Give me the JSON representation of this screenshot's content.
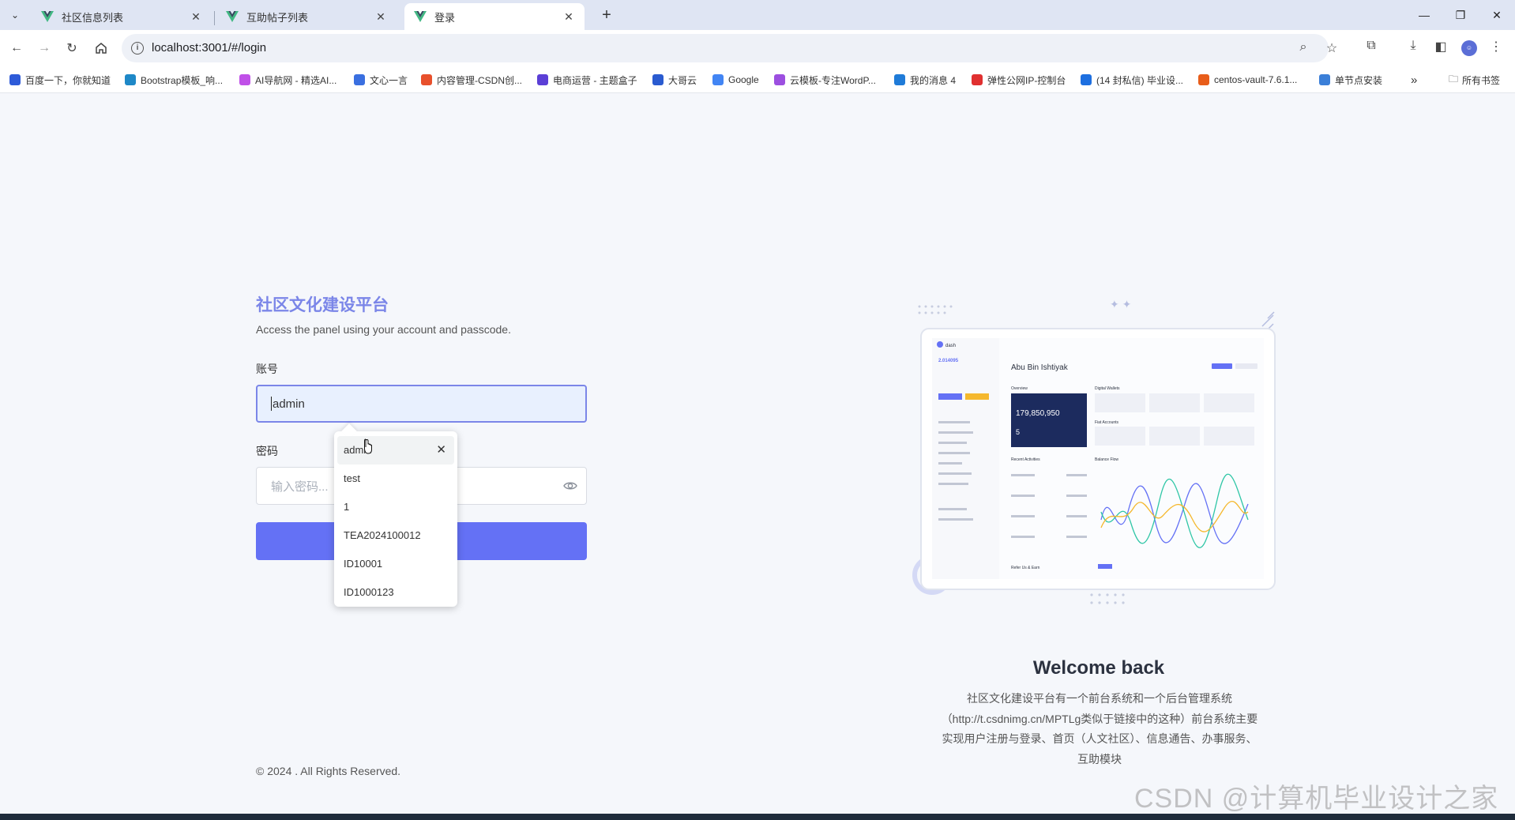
{
  "browser": {
    "tabs": [
      {
        "title": "社区信息列表",
        "active": false
      },
      {
        "title": "互助帖子列表",
        "active": false
      },
      {
        "title": "登录",
        "active": true
      }
    ],
    "url": "localhost:3001/#/login",
    "bookmarks": [
      {
        "label": "百度一下，你就知道",
        "icon_color": "#2e5bd8"
      },
      {
        "label": "Bootstrap模板_响...",
        "icon_color": "#1e88c7"
      },
      {
        "label": "AI导航网 - 精选AI...",
        "icon_color": "#c050e8"
      },
      {
        "label": "文心一言",
        "icon_color": "#3a6fe0"
      },
      {
        "label": "内容管理-CSDN创...",
        "icon_color": "#e8502c"
      },
      {
        "label": "电商运营 - 主题盒子",
        "icon_color": "#5b3fd6"
      },
      {
        "label": "大哥云",
        "icon_color": "#2a5bd0"
      },
      {
        "label": "Google",
        "icon_color": "#4285f4"
      },
      {
        "label": "云模板-专注WordP...",
        "icon_color": "#9c4fe0"
      },
      {
        "label": "我的消息 4",
        "icon_color": "#1f7bd8"
      },
      {
        "label": "弹性公网IP-控制台",
        "icon_color": "#e03030"
      },
      {
        "label": "(14 封私信) 毕业设...",
        "icon_color": "#1d6fe0"
      },
      {
        "label": "centos-vault-7.6.1...",
        "icon_color": "#e85d1a"
      },
      {
        "label": "单节点安装",
        "icon_color": "#3b7fd8"
      }
    ],
    "all_bookmarks_label": "所有书签",
    "more_label": "»"
  },
  "login": {
    "brand": "社区文化建设平台",
    "subtitle": "Access the panel using your account and passcode.",
    "account_label": "账号",
    "account_value": "admin",
    "password_label": "密码",
    "password_placeholder": "输入密码...",
    "submit_label": "",
    "copyright": "© 2024 . All Rights Reserved."
  },
  "autofill": {
    "items": [
      "admin",
      "test",
      "1",
      "TEA2024100012",
      "ID10001",
      "ID1000123"
    ]
  },
  "welcome": {
    "title": "Welcome back",
    "description": "社区文化建设平台有一个前台系统和一个后台管理系统（http://t.csdnimg.cn/MPTLg类似于链接中的这种）前台系统主要实现用户注册与登录、首页（人文社区）、信息通告、办事服务、互助模块"
  },
  "illustration": {
    "logo": "dash",
    "user_name": "Abu Bin Ishtiyak",
    "balance": "179,850,950",
    "wallet_count": "5",
    "sidebar_balance": "2.014095",
    "sections": [
      "Overview",
      "Digital Wallets",
      "Fiat Accounts",
      "Recent Activities",
      "Balance Flow",
      "Refer Us & Earn"
    ],
    "accent": "#6471f5",
    "dark": "#1c2b5e"
  },
  "watermark": "CSDN @计算机毕业设计之家",
  "colors": {
    "brand": "#7b86e8",
    "button": "#6471f5",
    "focus_bg": "#e8f0fe"
  }
}
